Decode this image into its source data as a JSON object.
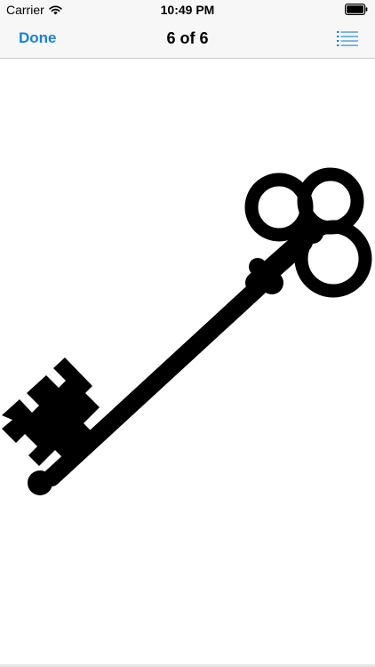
{
  "status_bar": {
    "carrier": "Carrier",
    "time": "10:49 PM",
    "icons": [
      "wifi-icon",
      "battery-icon"
    ]
  },
  "nav_bar": {
    "done_label": "Done",
    "title": "6 of 6",
    "list_icon": "list-icon"
  },
  "content": {
    "image": "skeleton-key-silhouette"
  },
  "colors": {
    "accent": "#1a82d9",
    "bar_background": "#f7f7f7",
    "key": "#000000"
  }
}
